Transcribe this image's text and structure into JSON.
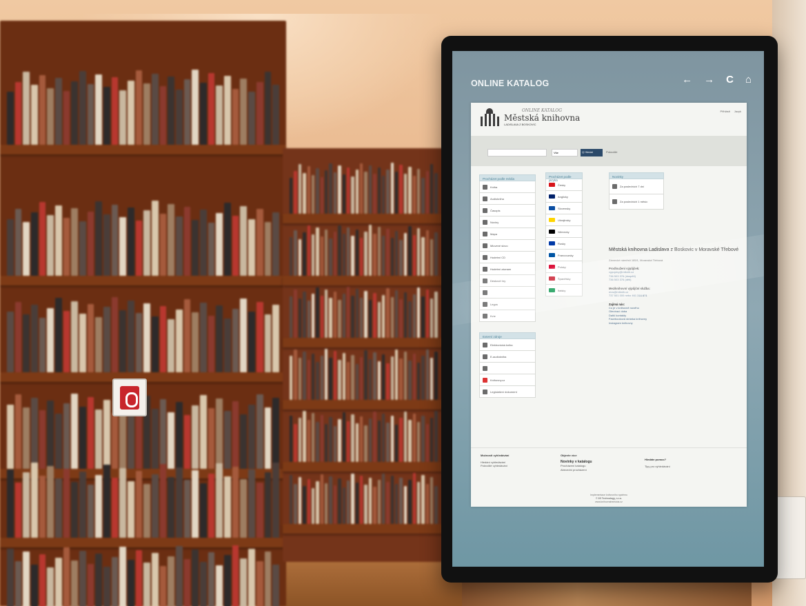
{
  "kiosk": {
    "app_title": "ONLINE KATALOG",
    "nav": {
      "back": "←",
      "forward": "→",
      "reload": "C",
      "home": "⌂"
    }
  },
  "catalog": {
    "header": {
      "logo_line1": "ONLINE KATALOG",
      "logo_line2": "Městská knihovna",
      "logo_line3": "LADISLAVA Z BOSKOVIC",
      "login": "Přihlásit",
      "language": "Jazyk"
    },
    "search": {
      "placeholder": "",
      "scope": "Vše",
      "button": "Q Hledat",
      "advanced": "Pokročilé"
    },
    "browse_type": {
      "title": "Procházet podle média",
      "items": [
        "Kniha",
        "Audiokniha",
        "Časopis",
        "Noviny",
        "Mapa",
        "Mluvené slovo",
        "Hudební CD",
        "Hudební záznam",
        "Deskové hry",
        "",
        "Legos",
        "Kvíz"
      ]
    },
    "external": {
      "title": "Externí zdroje",
      "items": [
        "Elektronická kniha",
        "E-audiokniha",
        "",
        "Knihovny.cz",
        "Legislativní dokument"
      ]
    },
    "browse_language": {
      "title": "Procházet podle jazyka",
      "items": [
        {
          "label": "Česky",
          "flag": "#d7141a"
        },
        {
          "label": "Anglicky",
          "flag": "#012169"
        },
        {
          "label": "Slovensky",
          "flag": "#0b4ea2"
        },
        {
          "label": "Ukrajinsky",
          "flag": "#ffd500"
        },
        {
          "label": "Německy",
          "flag": "#000000"
        },
        {
          "label": "Rusky",
          "flag": "#0039a6"
        },
        {
          "label": "Francouzsky",
          "flag": "#0055a4"
        },
        {
          "label": "Polsky",
          "flag": "#dc143c"
        },
        {
          "label": "Španělsky",
          "flag": "#c60b1e"
        },
        {
          "label": "Italsky",
          "flag": "#009246"
        }
      ]
    },
    "news": {
      "title": "Novinky",
      "items": [
        "Za posledních 7 dní",
        "Za posledních 1 měsíc"
      ]
    },
    "library": {
      "name": "Městská knihovna Ladislava z Boskovic v Moravské Třebové",
      "address": "Zámecké náměstí 185/1, Moravská Třebová",
      "lending_heading": "Prodloužení výpůjček:",
      "lending_email": "vypujcky@mtknih.cz",
      "lending_phone1": "736 503 376 (dospělí)",
      "lending_phone2": "736 503 376 (děti)",
      "mvs_heading": "Meziknihovní výpůjční služba:",
      "mvs_email": "mvs@mtknih.cz",
      "mvs_phone": "737 501 000 nebo 461 316 871",
      "links_heading": "Zajímá nás:",
      "links": [
        "Co je v knihovně nového",
        "Otevírací doba",
        "Další kontakty",
        "Facebooková stránka knihovny",
        "Instagram knihovny"
      ]
    },
    "footer": {
      "col1_title": "Možnosti vyhledávání",
      "col1_items": [
        "Hledání vyhledávání",
        "Pokročilé vyhledávání"
      ],
      "col2_title": "Objevte více",
      "col2_items": [
        "Novinky v katalogu",
        "Procházení katalogu",
        "Abecední procházení"
      ],
      "col3_title": "Hledáte pomoc?",
      "col3_items": [
        "Tipy pro vyhledávání"
      ],
      "credit1": "Implementace knihovního systému",
      "credit2": "© 3S Technology, s.r.o.",
      "credit3": "www.knihovnahedvicia.cz"
    }
  }
}
